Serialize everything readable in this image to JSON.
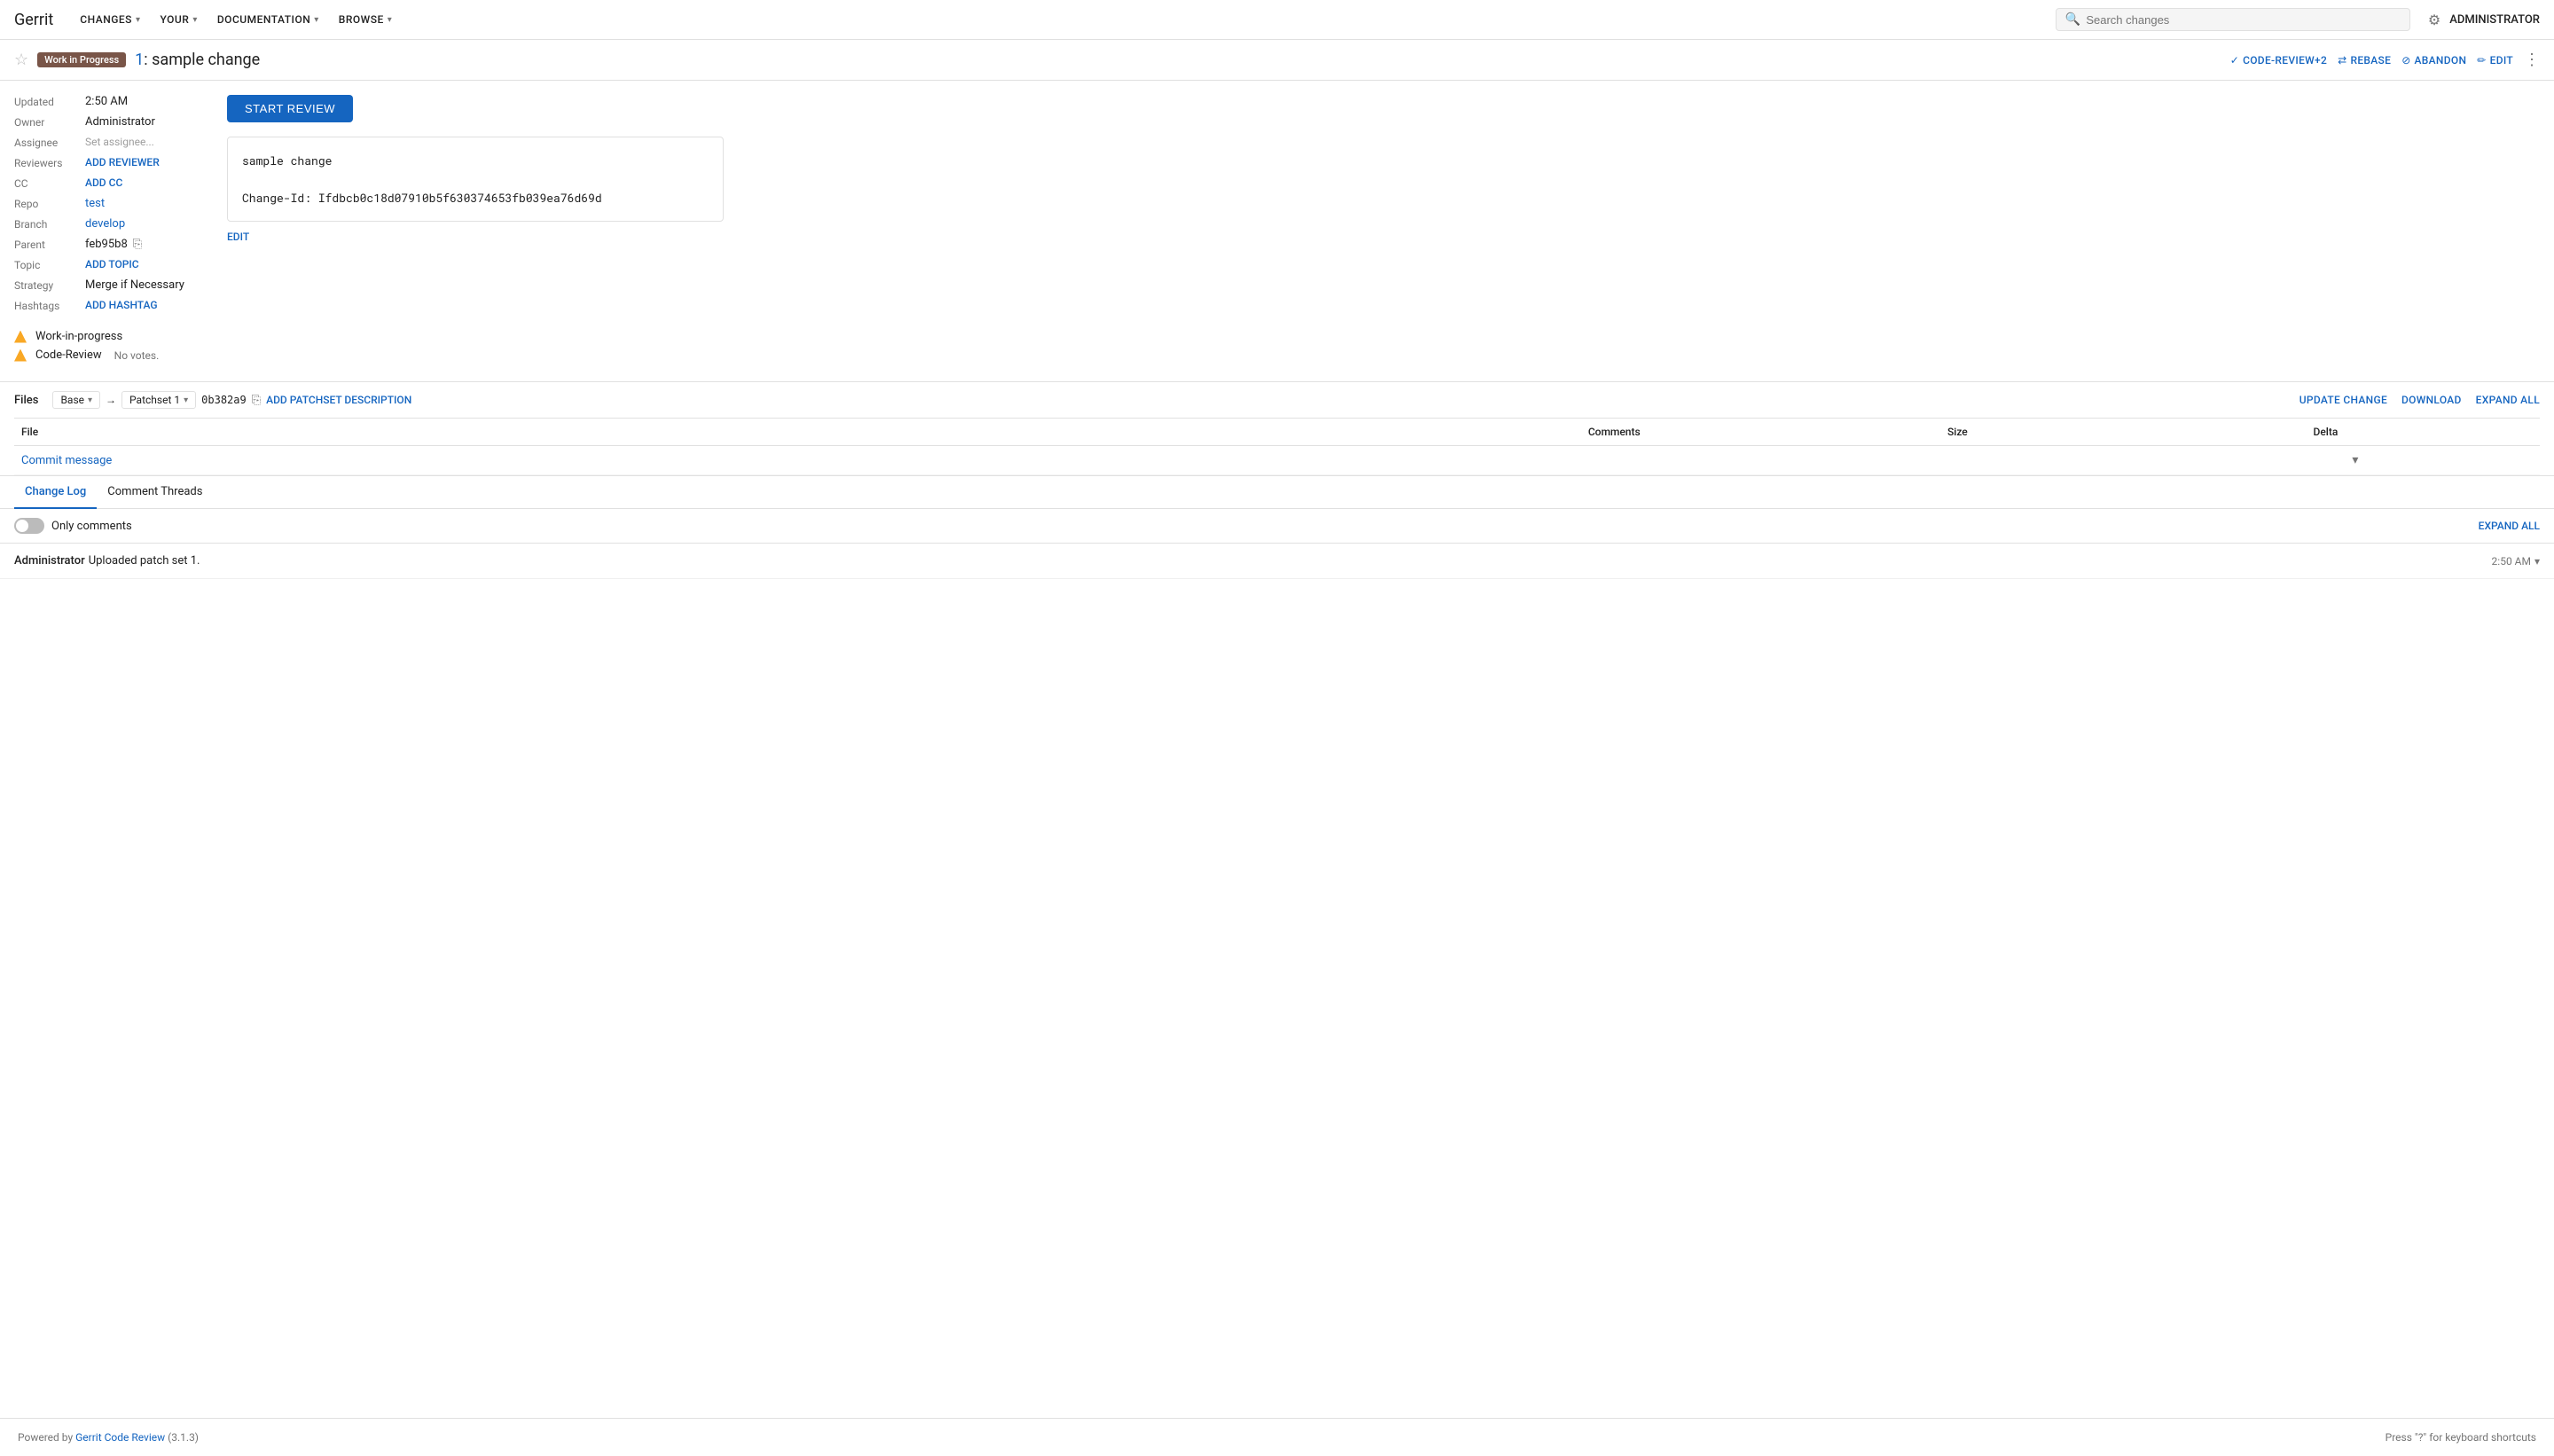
{
  "app": {
    "brand": "Gerrit"
  },
  "navbar": {
    "items": [
      {
        "label": "CHANGES",
        "id": "changes"
      },
      {
        "label": "YOUR",
        "id": "your"
      },
      {
        "label": "DOCUMENTATION",
        "id": "documentation"
      },
      {
        "label": "BROWSE",
        "id": "browse"
      }
    ],
    "search_placeholder": "Search changes",
    "admin_label": "ADMINISTRATOR"
  },
  "subheader": {
    "wip_label": "Work in Progress",
    "change_number": "1",
    "change_title": "sample change",
    "actions": {
      "code_review": "CODE-REVIEW+2",
      "rebase": "REBASE",
      "abandon": "ABANDON",
      "edit": "EDIT"
    }
  },
  "meta": {
    "updated_label": "Updated",
    "updated_value": "2:50 AM",
    "owner_label": "Owner",
    "owner_value": "Administrator",
    "assignee_label": "Assignee",
    "assignee_placeholder": "Set assignee...",
    "reviewers_label": "Reviewers",
    "reviewers_action": "ADD REVIEWER",
    "cc_label": "CC",
    "cc_action": "ADD CC",
    "repo_label": "Repo",
    "repo_value": "test",
    "branch_label": "Branch",
    "branch_value": "develop",
    "parent_label": "Parent",
    "parent_value": "feb95b8",
    "topic_label": "Topic",
    "topic_action": "ADD TOPIC",
    "strategy_label": "Strategy",
    "strategy_value": "Merge if Necessary",
    "hashtags_label": "Hashtags",
    "hashtags_action": "ADD HASHTAG"
  },
  "labels": [
    {
      "name": "Work-in-progress",
      "votes": ""
    },
    {
      "name": "Code-Review",
      "votes": "No votes."
    }
  ],
  "commit": {
    "start_review_btn": "START REVIEW",
    "message_line1": "sample change",
    "message_line2": "Change-Id: Ifdbcb0c18d07910b5f630374653fb039ea76d69d",
    "edit_link": "EDIT"
  },
  "files": {
    "title": "Files",
    "base_label": "Base",
    "patchset_label": "Patchset 1",
    "hash_value": "0b382a9",
    "add_patchset_desc": "ADD PATCHSET DESCRIPTION",
    "update_change": "UPDATE CHANGE",
    "download": "DOWNLOAD",
    "expand_all": "EXPAND ALL",
    "columns": {
      "file": "File",
      "comments": "Comments",
      "size": "Size",
      "delta": "Delta"
    },
    "rows": [
      {
        "name": "Commit message",
        "comments": "",
        "size": "",
        "delta": ""
      }
    ]
  },
  "changelog": {
    "tabs": [
      {
        "label": "Change Log",
        "active": true
      },
      {
        "label": "Comment Threads",
        "active": false
      }
    ],
    "only_comments_label": "Only comments",
    "expand_all_label": "EXPAND ALL",
    "activity": [
      {
        "user": "Administrator",
        "text": "Uploaded patch set 1.",
        "time": "2:50 AM"
      }
    ]
  },
  "footer": {
    "powered_by": "Powered by ",
    "link_text": "Gerrit Code Review",
    "version": "(3.1.3)",
    "keyboard_hint": "Press \"?\" for keyboard shortcuts"
  }
}
